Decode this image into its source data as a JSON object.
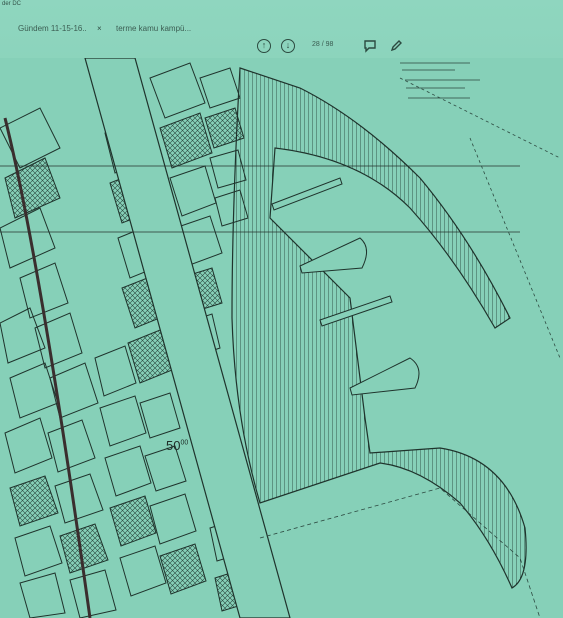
{
  "app": {
    "title": "der DC"
  },
  "tabs": [
    {
      "label": "Gündem 11-15-16..",
      "close": "×",
      "active": true
    },
    {
      "label": "terme kamu kampü...",
      "active": false
    }
  ],
  "toolbar": {
    "prev_icon": "arrow-up-circle-icon",
    "next_icon": "arrow-down-circle-icon",
    "page_current": "28",
    "page_separator": "/",
    "page_total": "98",
    "comment_icon": "comment-icon",
    "pen_icon": "pen-icon"
  },
  "map": {
    "label_value": "50",
    "label_sup": "00"
  },
  "colors": {
    "background": "#84cfb6",
    "ink": "#1e2e28"
  }
}
